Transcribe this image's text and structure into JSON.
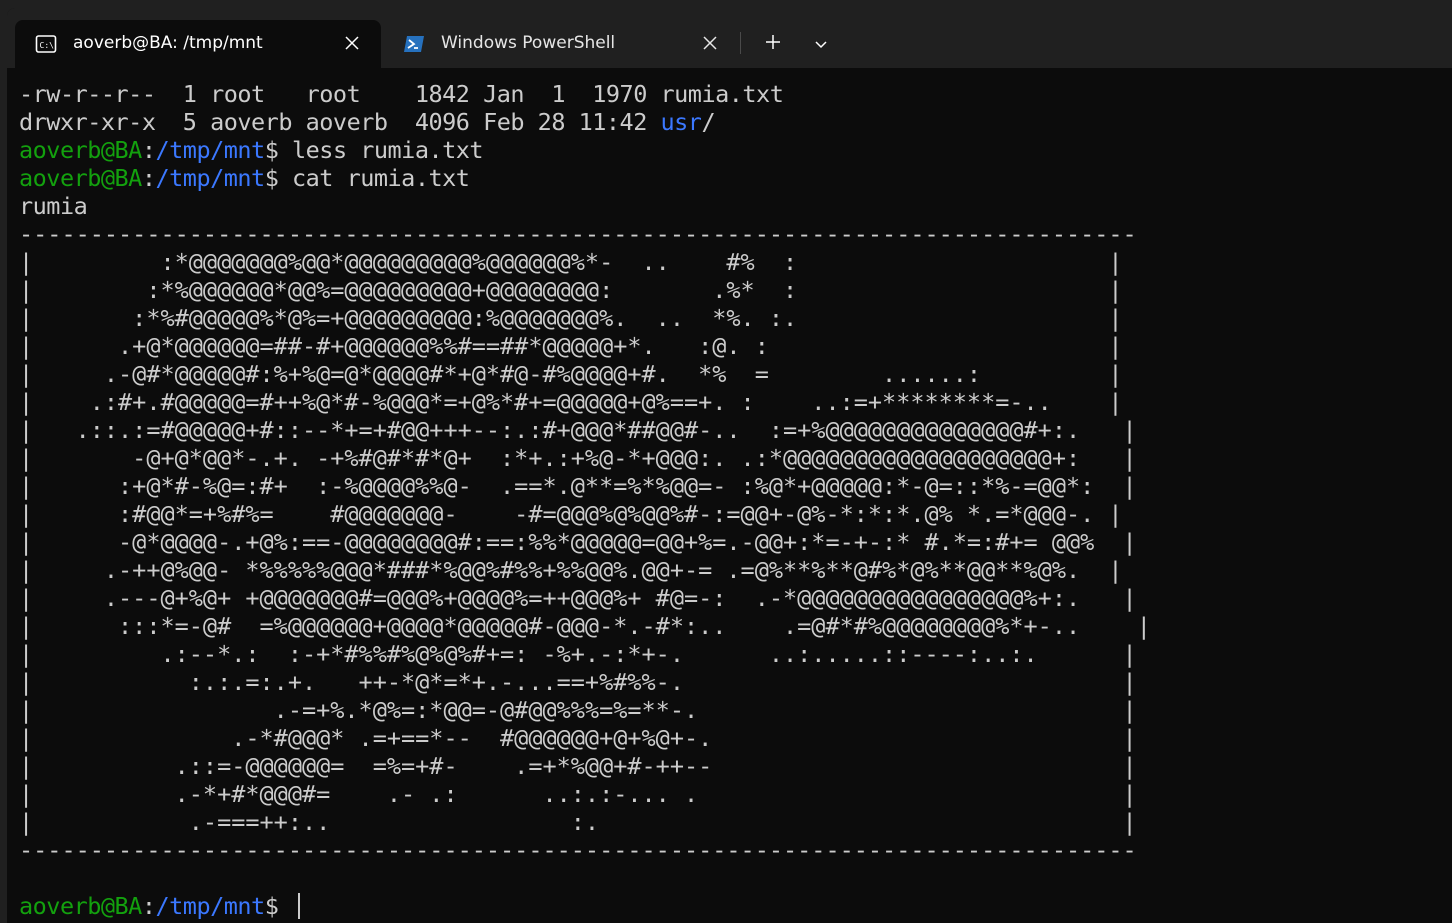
{
  "tabs": [
    {
      "title": "aoverb@BA: /tmp/mnt",
      "icon": "cmd-icon",
      "active": true
    },
    {
      "title": "Windows PowerShell",
      "icon": "powershell-icon",
      "active": false
    }
  ],
  "listing": [
    {
      "perms": "-rw-r--r--",
      "links": "1",
      "owner": "root",
      "group": "root",
      "size": "1842",
      "date": "Jan  1  1970",
      "name": "rumia.txt"
    },
    {
      "perms": "drwxr-xr-x",
      "links": "5",
      "owner": "aoverb",
      "group": "aoverb",
      "size": "4096",
      "date": "Feb 28 11:42",
      "name": "usr",
      "suffix": "/"
    }
  ],
  "prompt": {
    "user_host": "aoverb@BA",
    "sep": ":",
    "path": "/tmp/mnt",
    "symbol": "$"
  },
  "commands": [
    "less rumia.txt",
    "cat rumia.txt"
  ],
  "file_title": "rumia",
  "ascii_art": [
    "-------------------------------------------------------------------------------",
    "|         :*@@@@@@@%@@*@@@@@@@@@%@@@@@@%*-  ..    #%  :                      |",
    "|        :*%@@@@@@*@@%=@@@@@@@@@+@@@@@@@@:       .%*  :                      |",
    "|       :*%#@@@@@%*@%=+@@@@@@@@@:%@@@@@@@%.  ..  *%. :.                      |",
    "|      .+@*@@@@@@=##-#+@@@@@@%%#==##*@@@@@+*.   :@. :                        |",
    "|     .-@#*@@@@@#:%+%@=@*@@@@#*+@*#@-#%@@@@+#.  *%  =        ......:         |",
    "|    .:#+.#@@@@@=#++%@*#-%@@@*=+@%*#+=@@@@@+@%==+. :    ..:=+********=-..    |",
    "|   .::.:=#@@@@@+#::--*+=+#@@+++--:.:#+@@@*##@@#-..  :=+%@@@@@@@@@@@@@@#+:.   |",
    "|       -@+@*@@*-.+. -+%#@#*#*@+  :*+.:+%@-*+@@@:. .:*@@@@@@@@@@@@@@@@@@@+:   |",
    "|      :+@*#-%@=:#+  :-%@@@@%%@-  .==*.@**=%*%@@=- :%@*+@@@@@:*-@=::*%-=@@*:  |",
    "|      :#@@*=+%#%=    #@@@@@@@-    -#=@@@%@%@@%#-:=@@+-@%-*:*:*.@% *.=*@@@-. |",
    "|      -@*@@@@-.+@%:==-@@@@@@@@#:==:%%*@@@@@=@@+%=.-@@+:*=-+-:* #.*=:#+= @@%  |",
    "|     .-++@%@@- *%%%%%@@@*###*%@@%#%%+%%@@%.@@+-= .=@%**%**@#%*@%**@@**%@%.  |",
    "|     .---@+%@+ +@@@@@@@#=@@@%+@@@@%=++@@@%+ #@=-:  .-*@@@@@@@@@@@@@@@@%+:.   |",
    "|      :::*=-@#  =%@@@@@@+@@@@*@@@@@#-@@@-*.-#*:..    .=@#*#%@@@@@@@@%*+-..    |",
    "|         .:--*.:  :-+*#%%#%@%@%#+=: -%+.-:*+-.      ..:.....::----:..:.      |",
    "|           :.:.=:.+.   ++-*@*=*+.-...==+%#%%-.                               |",
    "|                 .-=+%.*@%=:*@@=-@#@@%%%=%=**-.                              |",
    "|              .-*#@@@* .=+==*--  #@@@@@@+@+%@+-.                             |",
    "|          .::=-@@@@@@=  =%=+#-    .=+*%@@+#-++--                             |",
    "|          .-*+#*@@@#=    .- .:      ..:.:-... .                              |",
    "|           .-===++:..                 :.                                     |",
    "-------------------------------------------------------------------------------"
  ],
  "colors": {
    "background": "#0c0c0c",
    "text": "#cccccc",
    "prompt_user": "#13a10e",
    "prompt_path": "#3b78ff",
    "tabbar": "#202020"
  }
}
